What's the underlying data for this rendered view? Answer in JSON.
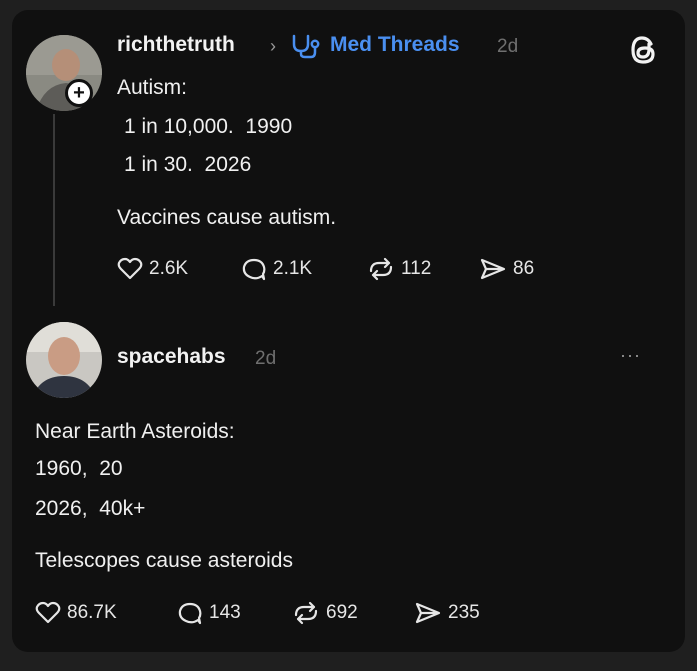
{
  "post1": {
    "username": "richthetruth",
    "chevron": "›",
    "channel": "Med Threads",
    "time": "2d",
    "lines": [
      "Autism:",
      "1 in 10,000.  1990",
      "1 in 30.  2026"
    ],
    "statement": "Vaccines cause autism.",
    "actions": {
      "likes": "2.6K",
      "comments": "2.1K",
      "reposts": "112",
      "shares": "86"
    },
    "icons": {
      "channel": "stethoscope-icon",
      "follow": "plus-icon",
      "logo": "threads-logo-icon"
    }
  },
  "post2": {
    "username": "spacehabs",
    "time": "2d",
    "more": "···",
    "lines": [
      "Near Earth Asteroids:",
      "1960,  20",
      "2026,  40k+"
    ],
    "statement": "Telescopes cause asteroids",
    "actions": {
      "likes": "86.7K",
      "comments": "143",
      "reposts": "692",
      "shares": "235"
    }
  },
  "colors": {
    "background": "#101010",
    "accent": "#4a8ff0",
    "muted": "#6f6f6f",
    "text": "#f2f2f2"
  }
}
